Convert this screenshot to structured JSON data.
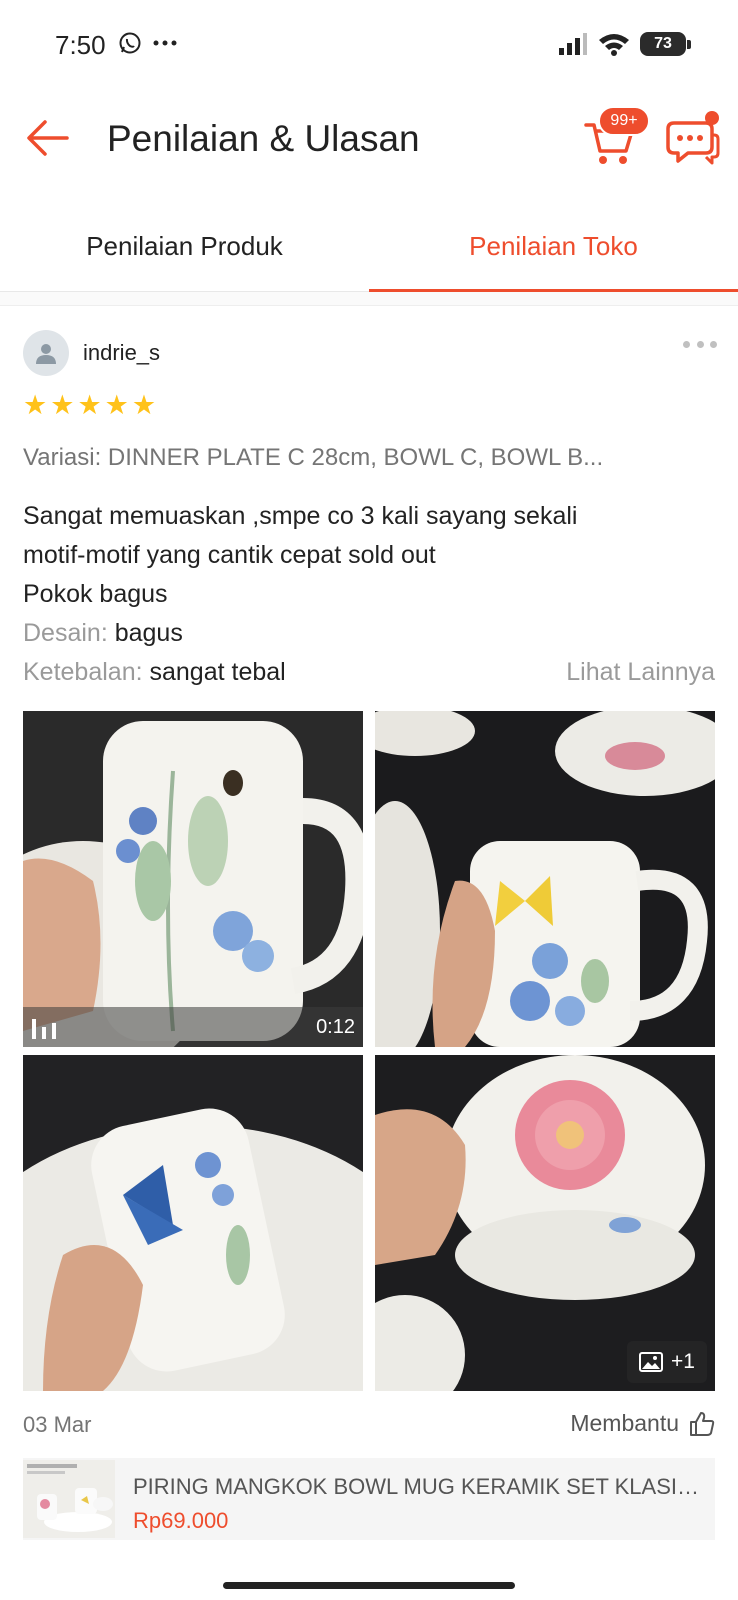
{
  "status_bar": {
    "time": "7:50",
    "battery": "73",
    "icons": [
      "whatsapp-icon",
      "more-dots-icon",
      "signal-icon",
      "wifi-icon",
      "battery-icon"
    ]
  },
  "header": {
    "title": "Penilaian & Ulasan",
    "cart_badge": "99+",
    "accent_color": "#ee4d2d"
  },
  "tabs": [
    {
      "label": "Penilaian Produk",
      "active": false
    },
    {
      "label": "Penilaian Toko",
      "active": true
    }
  ],
  "review": {
    "username": "indrie_s",
    "rating": 5,
    "variation": "Variasi: DINNER PLATE C 28cm, BOWL C, BOWL B...",
    "text_lines": [
      "Sangat memuaskan ,smpe co 3 kali sayang sekali",
      "motif-motif yang cantik cepat sold out",
      "Pokok bagus"
    ],
    "attributes": [
      {
        "label": "Desain:",
        "value": "bagus"
      },
      {
        "label": "Ketebalan:",
        "value": "sangat tebal"
      }
    ],
    "see_more": "Lihat Lainnya",
    "media": {
      "video_duration": "0:12",
      "more_count": "+1"
    },
    "date": "03 Mar",
    "helpful_label": "Membantu"
  },
  "product": {
    "name": "PIRING MANGKOK BOWL MUG KERAMIK SET KLASIK ...",
    "price": "Rp69.000"
  }
}
